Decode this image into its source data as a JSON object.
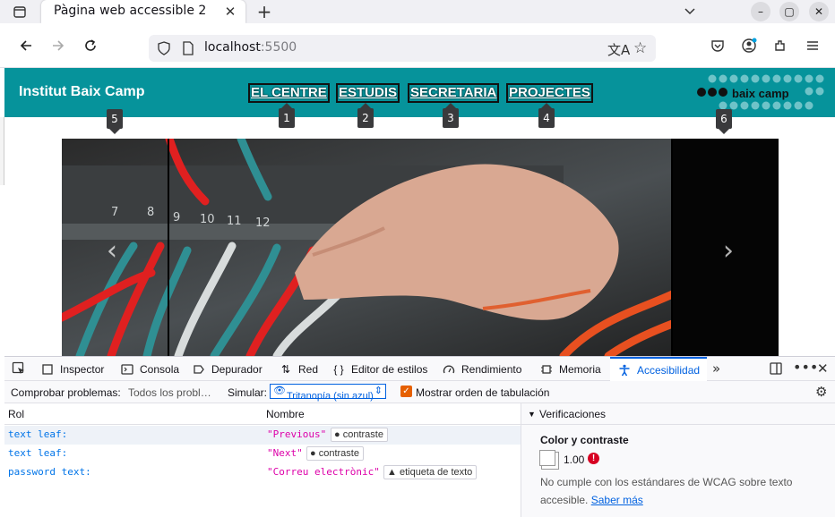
{
  "browser": {
    "tab_title": "Pàgina web accessible 2",
    "url_host": "localhost",
    "url_port": ":5500"
  },
  "site": {
    "title": "Institut Baix Camp",
    "nav": [
      "EL CENTRE",
      "ESTUDIS",
      "SECRETARIA",
      "PROJECTES"
    ],
    "logo_text": "baix camp",
    "tab_order_markers": [
      "1",
      "2",
      "3",
      "4",
      "5",
      "6"
    ],
    "brand_color": "#06939b"
  },
  "devtools": {
    "tabs": [
      "Inspector",
      "Consola",
      "Depurador",
      "Red",
      "Editor de estilos",
      "Rendimiento",
      "Memoria",
      "Accesibilidad"
    ],
    "active_tab": "Accesibilidad",
    "check_label": "Comprobar problemas:",
    "check_value": "Todos los probl…",
    "simulate_label": "Simular:",
    "simulate_value": "Tritanopía (sin azul)",
    "tab_order_label": "Mostrar orden de tabulación",
    "columns": {
      "role": "Rol",
      "name": "Nombre"
    },
    "rows": [
      {
        "role": "text leaf:",
        "name": "\"Previous\"",
        "badge": "contraste"
      },
      {
        "role": "text leaf:",
        "name": "\"Next\"",
        "badge": "contraste"
      },
      {
        "role": "password text:",
        "name": "\"Correu electrònic\"",
        "badge": "etiqueta de texto"
      }
    ],
    "side": {
      "header": "Verificaciones",
      "title": "Color y contraste",
      "ratio": "1.00",
      "description": "No cumple con los estándares de WCAG sobre texto accesible.",
      "link": "Saber más"
    }
  }
}
